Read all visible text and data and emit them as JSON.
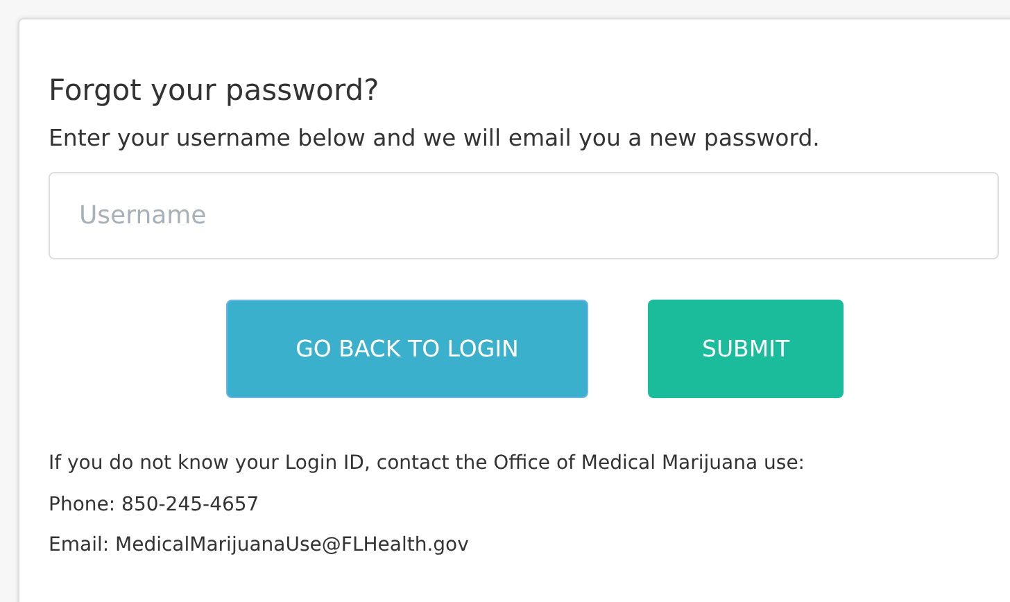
{
  "title": "Forgot your password?",
  "instructions": "Enter your username below and we will email you a new password.",
  "username_field": {
    "placeholder": "Username"
  },
  "buttons": [
    {
      "label": "GO BACK TO LOGIN",
      "kind": "secondary"
    },
    {
      "label": "SUBMIT",
      "kind": "primary"
    }
  ],
  "contact_lines": [
    "If you do not know your Login ID, contact the Office of Medical Marijuana use:",
    "Phone: 850-245-4657",
    "Email: MedicalMarijuanaUse@FLHealth.gov"
  ]
}
